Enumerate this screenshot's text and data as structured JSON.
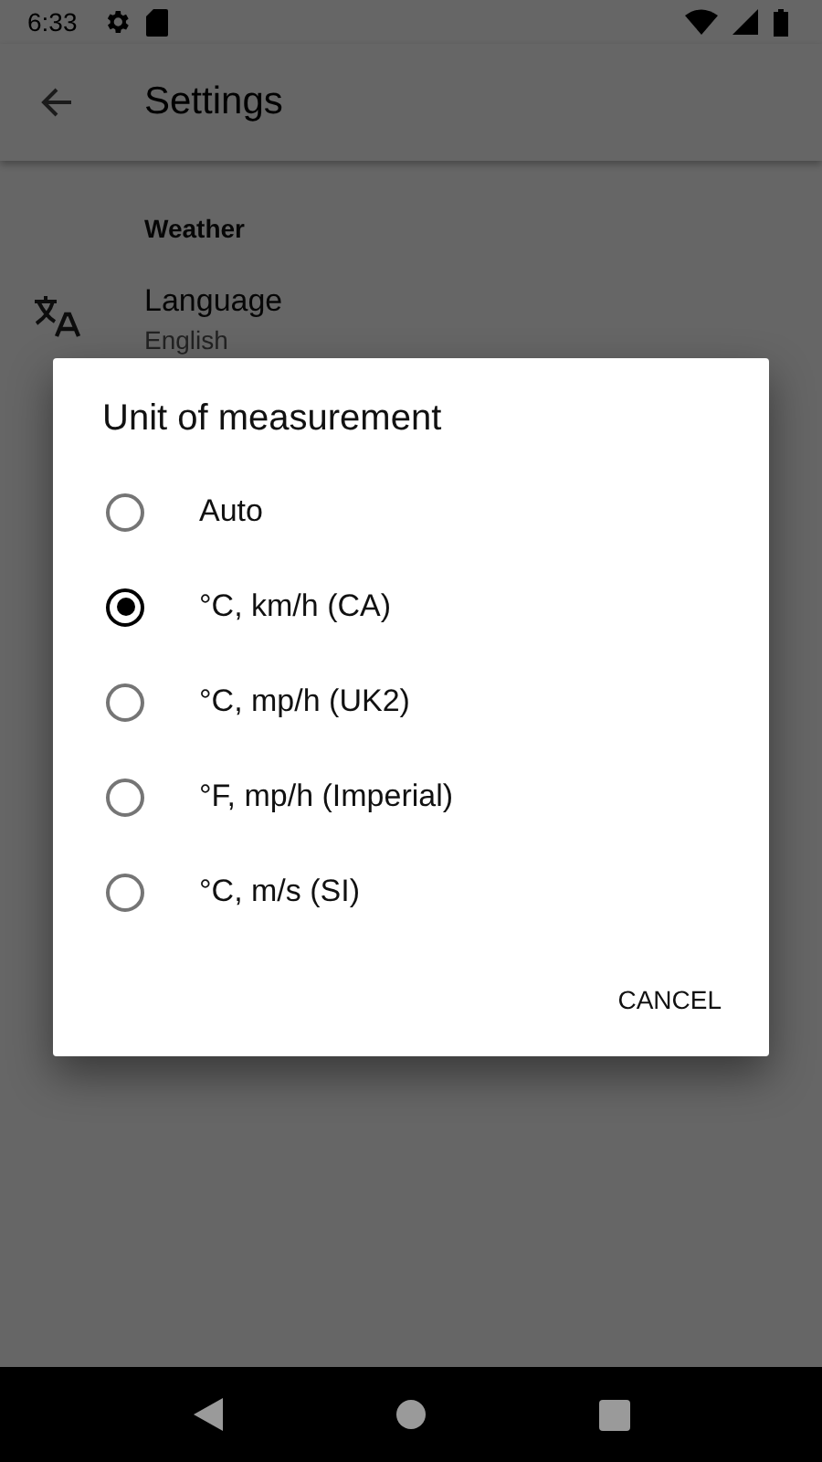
{
  "status_bar": {
    "time": "6:33"
  },
  "toolbar": {
    "title": "Settings"
  },
  "settings": {
    "section": "Weather",
    "items": [
      {
        "title": "Language",
        "summary": "English"
      }
    ]
  },
  "dialog": {
    "title": "Unit of measurement",
    "options": [
      {
        "label": "Auto",
        "selected": false
      },
      {
        "label": "°C, km/h (CA)",
        "selected": true
      },
      {
        "label": "°C, mp/h (UK2)",
        "selected": false
      },
      {
        "label": "°F, mp/h (Imperial)",
        "selected": false
      },
      {
        "label": "°C, m/s (SI)",
        "selected": false
      }
    ],
    "buttons": [
      "CANCEL"
    ]
  }
}
